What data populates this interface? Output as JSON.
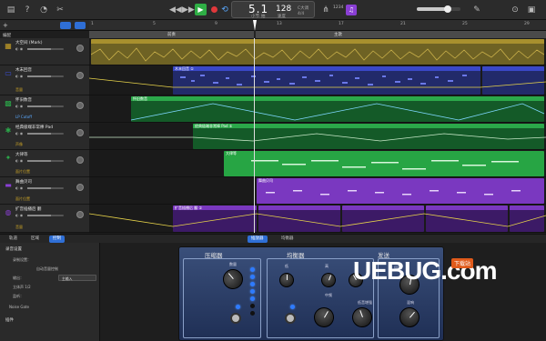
{
  "toolbar": {
    "lcd_position": "5.1",
    "lcd_beat_label": "小节",
    "lcd_beat_label2": "拍",
    "lcd_tempo": "128",
    "lcd_tempo_label": "速度",
    "lcd_key": "C大调",
    "lcd_sig": "4/4",
    "count_in": "1234"
  },
  "sidebar": {
    "header_label": "编配"
  },
  "ruler": {
    "marks": [
      "1",
      "5",
      "9",
      "13",
      "17",
      "21",
      "25",
      "29"
    ]
  },
  "sections": [
    {
      "label": "前奏",
      "color": "#555555"
    },
    {
      "label": "主歌",
      "color": "#555555"
    }
  ],
  "tracks": [
    {
      "name": "大空间 (Mark)",
      "sub": "",
      "color": "#c9a227",
      "icon": "piano-icon"
    },
    {
      "name": "木末回音",
      "sub": "音量",
      "color": "#3b4fd9",
      "icon": "bass-icon"
    },
    {
      "name": "怀旧数音",
      "sub": "LP Cutoff",
      "color": "#2ba84a",
      "icon": "synth-icon"
    },
    {
      "name": "经典极端非常棒 Pad",
      "sub": "声像",
      "color": "#2ba84a",
      "icon": "pad-icon"
    },
    {
      "name": "大律等",
      "sub": "面片位置",
      "color": "#2ba84a",
      "icon": "keys-icon"
    },
    {
      "name": "舞曲贝司",
      "sub": "面片位置",
      "color": "#8a3fd4",
      "icon": "synth-bass-icon"
    },
    {
      "name": "扩音插播后 翻",
      "sub": "音量",
      "color": "#8a3fd4",
      "icon": "drum-icon"
    }
  ],
  "regions": [
    {
      "track": 0,
      "label": "",
      "color": "#8a7a2a"
    },
    {
      "track": 1,
      "label": "木末回音 ①",
      "color": "#3040b0"
    },
    {
      "track": 2,
      "label": "怀旧数音",
      "color": "#1e8a3a"
    },
    {
      "track": 3,
      "label": "经典极端非常棒 Pad ①",
      "color": "#1e8a3a"
    },
    {
      "track": 4,
      "label": "大律等",
      "color": "#27a544"
    },
    {
      "track": 5,
      "label": "舞曲贝司",
      "color": "#7a38c0"
    },
    {
      "track": 6,
      "label": "扩音插播后 翻 ①",
      "color": "#6a2aa8"
    }
  ],
  "bottom_tabs": {
    "left": [
      "轨道",
      "区域",
      "控制"
    ],
    "center": [
      "插放器",
      "均衡器"
    ]
  },
  "inspector": {
    "title": "录音设置",
    "rows": [
      "录制设置：",
      "自动音量控制",
      "输出：",
      "立体声 1/2",
      "监听：",
      "Noise Gate",
      "插件"
    ],
    "input_label": "主输入"
  },
  "plugin": {
    "section_compressor": "压缩器",
    "section_eq": "均衡器",
    "section_sends": "发送",
    "comp_knob": "数量",
    "eq_bass": "低",
    "eq_mid": "中频",
    "eq_treble": "高",
    "eq_knob4": "中频",
    "eq_knob5": "低音增强",
    "send_reverb": "混响",
    "send_echo": "回声"
  },
  "watermark": {
    "brand": "UEBUG.com",
    "sub": "下载站"
  }
}
